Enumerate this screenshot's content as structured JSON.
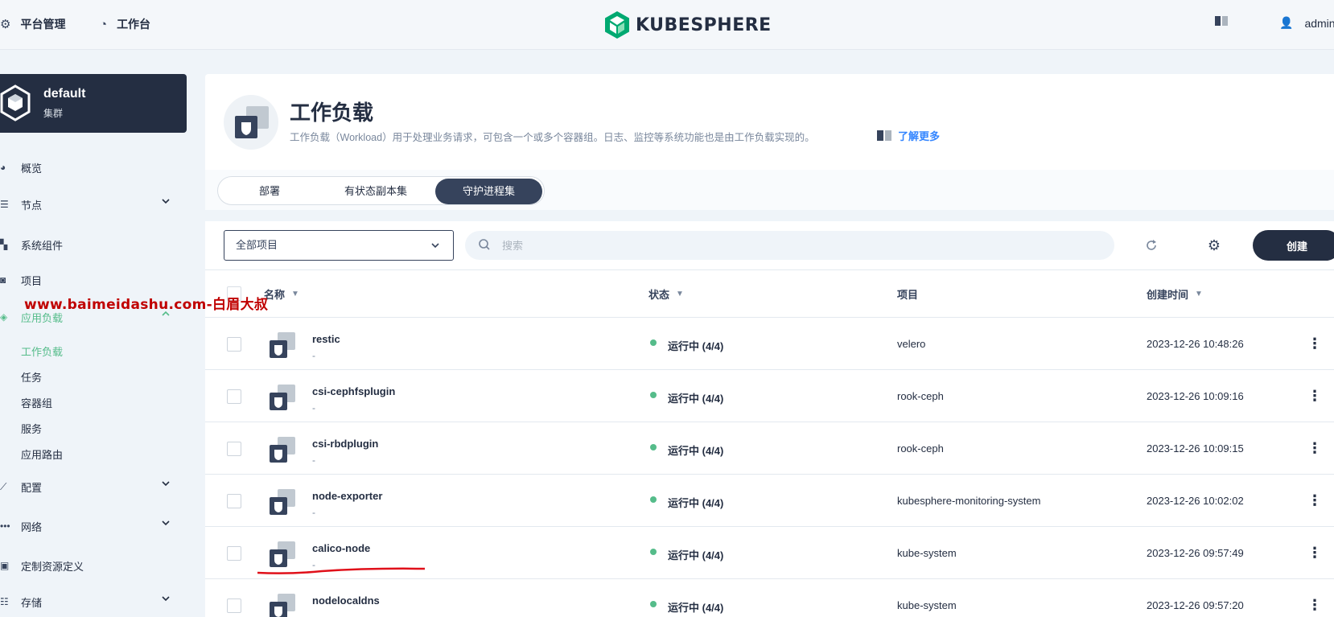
{
  "header": {
    "platform_label": "平台管理",
    "workbench_label": "工作台",
    "logo_text": "KUBESPHERE",
    "user_name": "admin"
  },
  "cluster": {
    "name": "default",
    "type": "集群"
  },
  "sidebar": {
    "items": [
      {
        "label": "概览"
      },
      {
        "label": "节点"
      },
      {
        "label": "系统组件"
      },
      {
        "label": "项目"
      },
      {
        "label": "应用负载"
      },
      {
        "label": "配置"
      },
      {
        "label": "网络"
      },
      {
        "label": "定制资源定义"
      },
      {
        "label": "存储"
      }
    ],
    "subitems": [
      {
        "label": "工作负载"
      },
      {
        "label": "任务"
      },
      {
        "label": "容器组"
      },
      {
        "label": "服务"
      },
      {
        "label": "应用路由"
      }
    ]
  },
  "watermark": "www.baimeidashu.com-白眉大叔",
  "page": {
    "title": "工作负载",
    "description": "工作负载（Workload）用于处理业务请求，可包含一个或多个容器组。日志、监控等系统功能也是由工作负载实现的。",
    "learn_more": "了解更多"
  },
  "tabs": [
    {
      "label": "部署"
    },
    {
      "label": "有状态副本集"
    },
    {
      "label": "守护进程集"
    }
  ],
  "toolbar": {
    "project_select": "全部项目",
    "search_placeholder": "搜索",
    "create_label": "创建"
  },
  "table": {
    "columns": {
      "name": "名称",
      "status": "状态",
      "project": "项目",
      "created": "创建时间"
    },
    "rows": [
      {
        "name": "restic",
        "sub": "-",
        "status": "运行中 (4/4)",
        "project": "velero",
        "created": "2023-12-26 10:48:26"
      },
      {
        "name": "csi-cephfsplugin",
        "sub": "-",
        "status": "运行中 (4/4)",
        "project": "rook-ceph",
        "created": "2023-12-26 10:09:16"
      },
      {
        "name": "csi-rbdplugin",
        "sub": "-",
        "status": "运行中 (4/4)",
        "project": "rook-ceph",
        "created": "2023-12-26 10:09:15"
      },
      {
        "name": "node-exporter",
        "sub": "-",
        "status": "运行中 (4/4)",
        "project": "kubesphere-monitoring-system",
        "created": "2023-12-26 10:02:02"
      },
      {
        "name": "calico-node",
        "sub": "-",
        "status": "运行中 (4/4)",
        "project": "kube-system",
        "created": "2023-12-26 09:57:49"
      },
      {
        "name": "nodelocaldns",
        "sub": "-",
        "status": "运行中 (4/4)",
        "project": "kube-system",
        "created": "2023-12-26 09:57:20"
      }
    ]
  },
  "colors": {
    "primary_dark": "#242e42",
    "accent_green": "#55bc8a",
    "link_blue": "#3385ff",
    "annotation_red": "#e0101a"
  }
}
